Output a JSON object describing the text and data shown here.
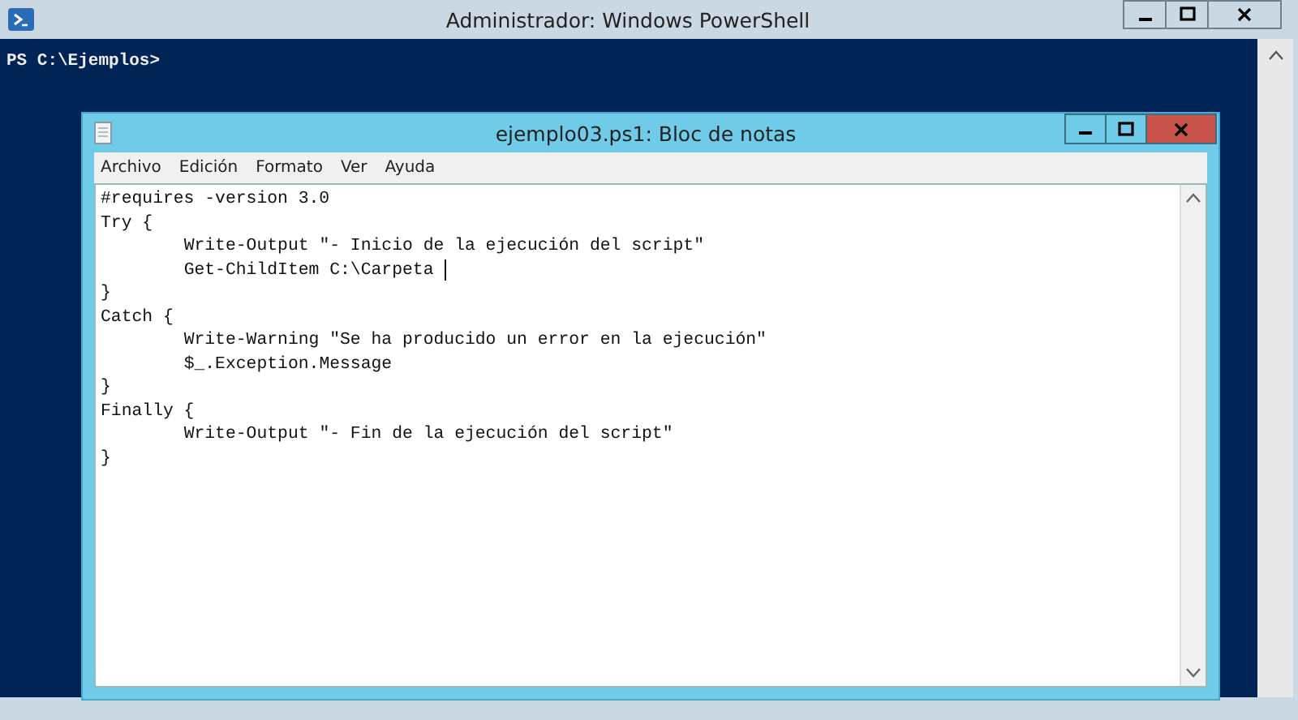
{
  "window": {
    "title": "Administrador: Windows PowerShell"
  },
  "console": {
    "prompt": "PS C:\\Ejemplos>"
  },
  "notepad": {
    "title": "ejemplo03.ps1: Bloc de notas",
    "menu": [
      "Archivo",
      "Edición",
      "Formato",
      "Ver",
      "Ayuda"
    ],
    "lines": [
      {
        "text": "#requires -version 3.0",
        "caret": false
      },
      {
        "text": "Try {",
        "caret": false
      },
      {
        "text": "\tWrite-Output \"- Inicio de la ejecución del script\"",
        "caret": false
      },
      {
        "text": "\tGet-ChildItem C:\\Carpeta ",
        "caret": true
      },
      {
        "text": "}",
        "caret": false
      },
      {
        "text": "Catch {",
        "caret": false
      },
      {
        "text": "\tWrite-Warning \"Se ha producido un error en la ejecución\"",
        "caret": false
      },
      {
        "text": "\t$_.Exception.Message",
        "caret": false
      },
      {
        "text": "}",
        "caret": false
      },
      {
        "text": "Finally {",
        "caret": false
      },
      {
        "text": "\tWrite-Output \"- Fin de la ejecución del script\"",
        "caret": false
      },
      {
        "text": "}",
        "caret": false
      }
    ]
  }
}
